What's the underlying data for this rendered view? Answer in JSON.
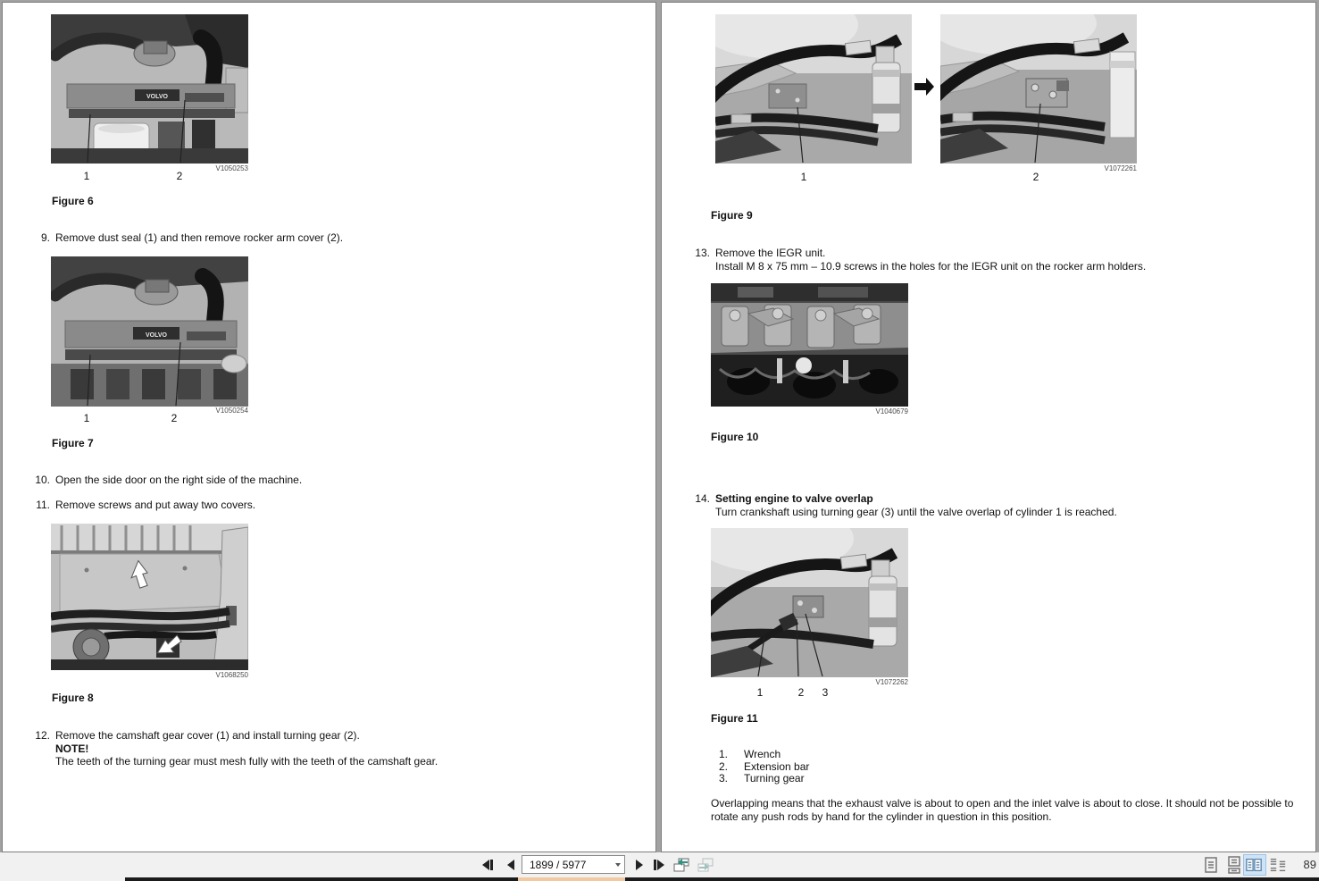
{
  "toolbar": {
    "page_field": "1899 / 5977",
    "zoom_label": "89"
  },
  "colors": {
    "selected_view_highlight": "#cfe3f6",
    "history_arrow_teal": "#2f9384",
    "taskbar_accent": "#f2c9a0"
  },
  "photos": {
    "brand": "VOLVO"
  },
  "left_page": {
    "figure6": {
      "caption": "Figure 6",
      "watermark": "V1050253",
      "label1": "1",
      "label2": "2"
    },
    "step9": {
      "num": "9.",
      "text": "Remove dust seal (1) and then remove rocker arm cover (2)."
    },
    "figure7": {
      "caption": "Figure 7",
      "watermark": "V1050254",
      "label1": "1",
      "label2": "2"
    },
    "step10": {
      "num": "10.",
      "text": "Open the side door on the right side of the machine."
    },
    "step11": {
      "num": "11.",
      "text": "Remove screws and put away two covers."
    },
    "figure8": {
      "caption": "Figure 8",
      "watermark": "V1068250"
    },
    "step12": {
      "num": "12.",
      "text": "Remove the camshaft gear cover (1) and install turning gear (2).",
      "note_label": "NOTE!",
      "note_text": "The teeth of the turning gear must mesh fully with the teeth of the camshaft gear."
    }
  },
  "right_page": {
    "figure9": {
      "caption": "Figure 9",
      "watermark": "V1072261",
      "label1": "1",
      "label2": "2"
    },
    "step13": {
      "num": "13.",
      "line1": "Remove the IEGR unit.",
      "line2": "Install M 8 x 75 mm – 10.9 screws in the holes for the IEGR unit on the rocker arm holders."
    },
    "figure10": {
      "caption": "Figure 10",
      "watermark": "V1040679"
    },
    "step14": {
      "num": "14.",
      "heading": "Setting engine to valve overlap",
      "text": "Turn crankshaft using turning gear (3) until the valve overlap of cylinder 1 is reached."
    },
    "figure11": {
      "caption": "Figure 11",
      "watermark": "V1072262",
      "label1": "1",
      "label2": "2",
      "label3": "3"
    },
    "legend": [
      {
        "num": "1.",
        "label": "Wrench"
      },
      {
        "num": "2.",
        "label": "Extension bar"
      },
      {
        "num": "3.",
        "label": "Turning gear"
      }
    ],
    "closing": "Overlapping means that the exhaust valve is about to open and the inlet valve is about to close. It should not be possible to rotate any push rods by hand for the cylinder in question in this position."
  }
}
